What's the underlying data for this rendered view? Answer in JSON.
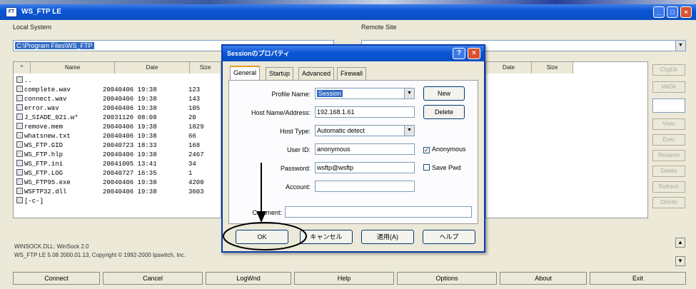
{
  "window": {
    "title": "WS_FTP LE"
  },
  "local": {
    "group_title": "Local System",
    "path": "C:\\Program Files\\WS_FTP",
    "columns": [
      "",
      "Name",
      "Date",
      "Size"
    ],
    "files": [
      {
        "name": "..",
        "date": "",
        "size": ""
      },
      {
        "name": "complete.wav",
        "date": "20040406 19:38",
        "size": "123"
      },
      {
        "name": "connect.wav",
        "date": "20040406 19:38",
        "size": "143"
      },
      {
        "name": "error.wav",
        "date": "20040406 19:38",
        "size": "105"
      },
      {
        "name": "J_SIADE_021.w*",
        "date": "20031126 08:08",
        "size": "20"
      },
      {
        "name": "remove.mem",
        "date": "20040406 19:38",
        "size": "1829"
      },
      {
        "name": "whatsnew.txt",
        "date": "20040406 19:38",
        "size": "66"
      },
      {
        "name": "WS_FTP.GID",
        "date": "20040723 18:33",
        "size": "168"
      },
      {
        "name": "WS_FTP.hlp",
        "date": "20040406 19:38",
        "size": "2467"
      },
      {
        "name": "WS_FTP.ini",
        "date": "20041005 13:41",
        "size": "34"
      },
      {
        "name": "WS_FTP.LOG",
        "date": "20040727 16:35",
        "size": "1"
      },
      {
        "name": "WS_FTP95.exe",
        "date": "20040406 19:38",
        "size": "4200"
      },
      {
        "name": "WSFTP32.dll",
        "date": "20040406 19:38",
        "size": "3603"
      },
      {
        "name": "[-c-]",
        "date": "",
        "size": ""
      }
    ]
  },
  "remote": {
    "group_title": "Remote Site",
    "columns": [
      "Date",
      "Size"
    ],
    "buttons": [
      "ChgDir",
      "MkDir",
      "",
      "View",
      "Exec",
      "Rename",
      "Delete",
      "Refresh",
      "DirInfo"
    ]
  },
  "status": {
    "line1": "WINSOCK.DLL: WinSock 2.0",
    "line2": "WS_FTP LE 5.08 2000.01.13, Copyright © 1992-2000 Ipswitch, Inc."
  },
  "bottom_buttons": [
    "Connect",
    "Cancel",
    "LogWnd",
    "Help",
    "Options",
    "About",
    "Exit"
  ],
  "dialog": {
    "title": "Sessionのプロパティ",
    "title_buttons": [
      "?",
      "×"
    ],
    "tabs": [
      "General",
      "Startup",
      "Advanced",
      "Firewall"
    ],
    "fields": {
      "profile_name_label": "Profile Name:",
      "profile_name_value": "Session",
      "host_label": "Host Name/Address:",
      "host_value": "192.168.1.61",
      "host_type_label": "Host Type:",
      "host_type_value": "Automatic detect",
      "user_id_label": "User ID:",
      "user_id_value": "anonymous",
      "password_label": "Password:",
      "password_value": "wsftp@wsftp",
      "account_label": "Account:",
      "account_value": "",
      "comment_label": "Comment:",
      "comment_value": ""
    },
    "side_buttons": [
      "New",
      "Delete"
    ],
    "anonymous_label": "Anonymous",
    "save_pwd_label": "Save Pwd",
    "footer_buttons": [
      "OK",
      "キャンセル",
      "適用(A)",
      "ヘルプ"
    ]
  },
  "annotation": {
    "highlighted_button": "OK"
  },
  "colors": {
    "title_blue": "#0a56d6",
    "close_red": "#d8512e",
    "selection": "#316ac5"
  }
}
